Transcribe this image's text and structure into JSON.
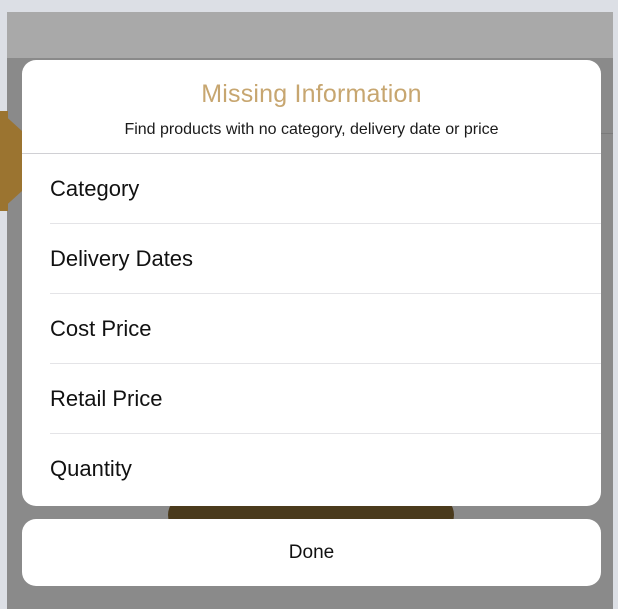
{
  "dialog": {
    "title": "Missing Information",
    "subtitle": "Find products with no category, delivery date or price"
  },
  "options": [
    {
      "label": "Category"
    },
    {
      "label": "Delivery Dates"
    },
    {
      "label": "Cost Price"
    },
    {
      "label": "Retail Price"
    },
    {
      "label": "Quantity"
    }
  ],
  "done_button": {
    "label": "Done"
  },
  "colors": {
    "title_color": "#c7a670",
    "callout_color": "#9b7430"
  }
}
